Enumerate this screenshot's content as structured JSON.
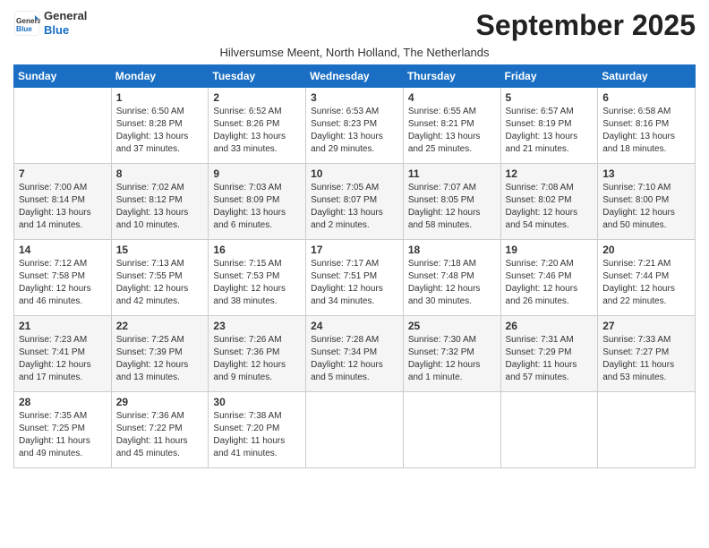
{
  "header": {
    "logo_line1": "General",
    "logo_line2": "Blue",
    "month_title": "September 2025",
    "subtitle": "Hilversumse Meent, North Holland, The Netherlands"
  },
  "days_of_week": [
    "Sunday",
    "Monday",
    "Tuesday",
    "Wednesday",
    "Thursday",
    "Friday",
    "Saturday"
  ],
  "weeks": [
    [
      {
        "day": "",
        "info": ""
      },
      {
        "day": "1",
        "info": "Sunrise: 6:50 AM\nSunset: 8:28 PM\nDaylight: 13 hours\nand 37 minutes."
      },
      {
        "day": "2",
        "info": "Sunrise: 6:52 AM\nSunset: 8:26 PM\nDaylight: 13 hours\nand 33 minutes."
      },
      {
        "day": "3",
        "info": "Sunrise: 6:53 AM\nSunset: 8:23 PM\nDaylight: 13 hours\nand 29 minutes."
      },
      {
        "day": "4",
        "info": "Sunrise: 6:55 AM\nSunset: 8:21 PM\nDaylight: 13 hours\nand 25 minutes."
      },
      {
        "day": "5",
        "info": "Sunrise: 6:57 AM\nSunset: 8:19 PM\nDaylight: 13 hours\nand 21 minutes."
      },
      {
        "day": "6",
        "info": "Sunrise: 6:58 AM\nSunset: 8:16 PM\nDaylight: 13 hours\nand 18 minutes."
      }
    ],
    [
      {
        "day": "7",
        "info": "Sunrise: 7:00 AM\nSunset: 8:14 PM\nDaylight: 13 hours\nand 14 minutes."
      },
      {
        "day": "8",
        "info": "Sunrise: 7:02 AM\nSunset: 8:12 PM\nDaylight: 13 hours\nand 10 minutes."
      },
      {
        "day": "9",
        "info": "Sunrise: 7:03 AM\nSunset: 8:09 PM\nDaylight: 13 hours\nand 6 minutes."
      },
      {
        "day": "10",
        "info": "Sunrise: 7:05 AM\nSunset: 8:07 PM\nDaylight: 13 hours\nand 2 minutes."
      },
      {
        "day": "11",
        "info": "Sunrise: 7:07 AM\nSunset: 8:05 PM\nDaylight: 12 hours\nand 58 minutes."
      },
      {
        "day": "12",
        "info": "Sunrise: 7:08 AM\nSunset: 8:02 PM\nDaylight: 12 hours\nand 54 minutes."
      },
      {
        "day": "13",
        "info": "Sunrise: 7:10 AM\nSunset: 8:00 PM\nDaylight: 12 hours\nand 50 minutes."
      }
    ],
    [
      {
        "day": "14",
        "info": "Sunrise: 7:12 AM\nSunset: 7:58 PM\nDaylight: 12 hours\nand 46 minutes."
      },
      {
        "day": "15",
        "info": "Sunrise: 7:13 AM\nSunset: 7:55 PM\nDaylight: 12 hours\nand 42 minutes."
      },
      {
        "day": "16",
        "info": "Sunrise: 7:15 AM\nSunset: 7:53 PM\nDaylight: 12 hours\nand 38 minutes."
      },
      {
        "day": "17",
        "info": "Sunrise: 7:17 AM\nSunset: 7:51 PM\nDaylight: 12 hours\nand 34 minutes."
      },
      {
        "day": "18",
        "info": "Sunrise: 7:18 AM\nSunset: 7:48 PM\nDaylight: 12 hours\nand 30 minutes."
      },
      {
        "day": "19",
        "info": "Sunrise: 7:20 AM\nSunset: 7:46 PM\nDaylight: 12 hours\nand 26 minutes."
      },
      {
        "day": "20",
        "info": "Sunrise: 7:21 AM\nSunset: 7:44 PM\nDaylight: 12 hours\nand 22 minutes."
      }
    ],
    [
      {
        "day": "21",
        "info": "Sunrise: 7:23 AM\nSunset: 7:41 PM\nDaylight: 12 hours\nand 17 minutes."
      },
      {
        "day": "22",
        "info": "Sunrise: 7:25 AM\nSunset: 7:39 PM\nDaylight: 12 hours\nand 13 minutes."
      },
      {
        "day": "23",
        "info": "Sunrise: 7:26 AM\nSunset: 7:36 PM\nDaylight: 12 hours\nand 9 minutes."
      },
      {
        "day": "24",
        "info": "Sunrise: 7:28 AM\nSunset: 7:34 PM\nDaylight: 12 hours\nand 5 minutes."
      },
      {
        "day": "25",
        "info": "Sunrise: 7:30 AM\nSunset: 7:32 PM\nDaylight: 12 hours\nand 1 minute."
      },
      {
        "day": "26",
        "info": "Sunrise: 7:31 AM\nSunset: 7:29 PM\nDaylight: 11 hours\nand 57 minutes."
      },
      {
        "day": "27",
        "info": "Sunrise: 7:33 AM\nSunset: 7:27 PM\nDaylight: 11 hours\nand 53 minutes."
      }
    ],
    [
      {
        "day": "28",
        "info": "Sunrise: 7:35 AM\nSunset: 7:25 PM\nDaylight: 11 hours\nand 49 minutes."
      },
      {
        "day": "29",
        "info": "Sunrise: 7:36 AM\nSunset: 7:22 PM\nDaylight: 11 hours\nand 45 minutes."
      },
      {
        "day": "30",
        "info": "Sunrise: 7:38 AM\nSunset: 7:20 PM\nDaylight: 11 hours\nand 41 minutes."
      },
      {
        "day": "",
        "info": ""
      },
      {
        "day": "",
        "info": ""
      },
      {
        "day": "",
        "info": ""
      },
      {
        "day": "",
        "info": ""
      }
    ]
  ]
}
